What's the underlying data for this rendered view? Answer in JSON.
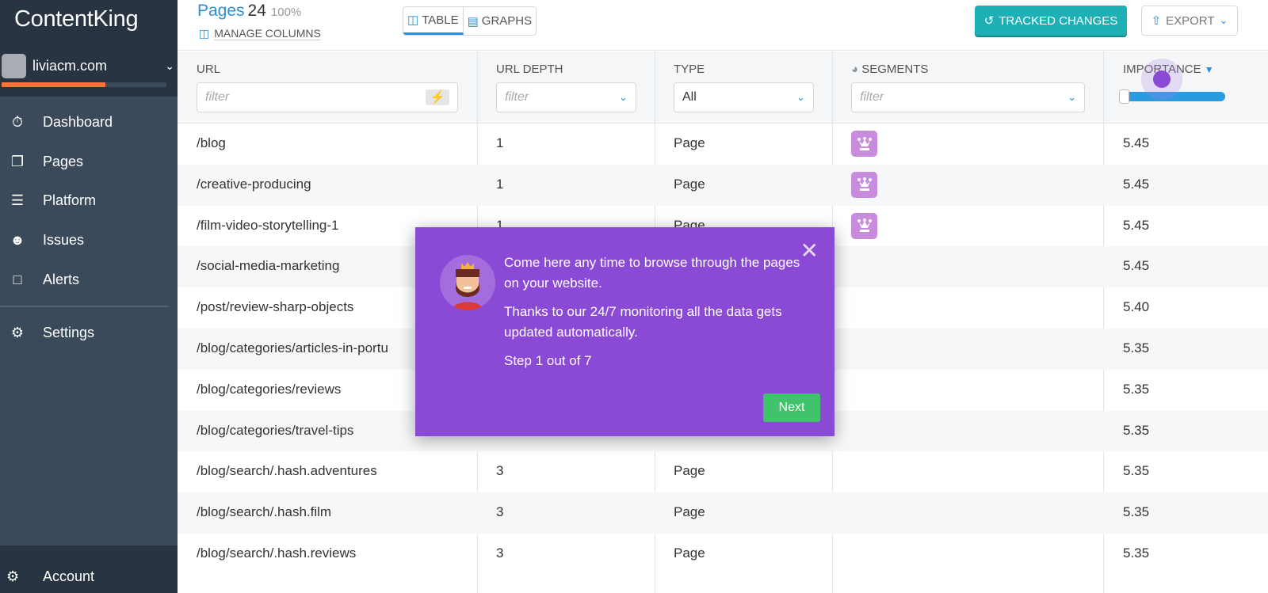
{
  "sidebar": {
    "logo": "ContentKing",
    "site": "liviacm.com",
    "site_progress": 0.63,
    "items": [
      {
        "label": "Dashboard",
        "icon": "gauge-icon"
      },
      {
        "label": "Pages",
        "icon": "pages-icon"
      },
      {
        "label": "Platform",
        "icon": "layers-icon"
      },
      {
        "label": "Issues",
        "icon": "bug-icon"
      },
      {
        "label": "Alerts",
        "icon": "pulse-icon"
      }
    ],
    "settings": "Settings",
    "account": "Account"
  },
  "header": {
    "title": "Pages",
    "count": "24",
    "percent": "100%",
    "manage_columns": "MANAGE COLUMNS",
    "table": "TABLE",
    "graphs": "GRAPHS",
    "tracked_changes": "TRACKED CHANGES",
    "export": "EXPORT"
  },
  "columns": {
    "url": "URL",
    "url_depth": "URL DEPTH",
    "type": "TYPE",
    "segments": "SEGMENTS",
    "importance": "IMPORTANCE",
    "filter_placeholder": "filter",
    "type_value": "All"
  },
  "rows": [
    {
      "url": "/blog",
      "depth": "1",
      "type": "Page",
      "segment": true,
      "importance": "5.45"
    },
    {
      "url": "/creative-producing",
      "depth": "1",
      "type": "Page",
      "segment": true,
      "importance": "5.45"
    },
    {
      "url": "/film-video-storytelling-1",
      "depth": "1",
      "type": "Page",
      "segment": true,
      "importance": "5.45"
    },
    {
      "url": "/social-media-marketing",
      "depth": "",
      "type": "",
      "segment": false,
      "importance": "5.45"
    },
    {
      "url": "/post/review-sharp-objects",
      "depth": "",
      "type": "",
      "segment": false,
      "importance": "5.40"
    },
    {
      "url": "/blog/categories/articles-in-portu",
      "depth": "",
      "type": "",
      "segment": false,
      "importance": "5.35"
    },
    {
      "url": "/blog/categories/reviews",
      "depth": "",
      "type": "",
      "segment": false,
      "importance": "5.35"
    },
    {
      "url": "/blog/categories/travel-tips",
      "depth": "",
      "type": "",
      "segment": false,
      "importance": "5.35"
    },
    {
      "url": "/blog/search/.hash.adventures",
      "depth": "3",
      "type": "Page",
      "segment": false,
      "importance": "5.35"
    },
    {
      "url": "/blog/search/.hash.film",
      "depth": "3",
      "type": "Page",
      "segment": false,
      "importance": "5.35"
    },
    {
      "url": "/blog/search/.hash.reviews",
      "depth": "3",
      "type": "Page",
      "segment": false,
      "importance": "5.35"
    }
  ],
  "popup": {
    "line1": "Come here any time to browse through the pages on your website.",
    "line2": "Thanks to our 24/7 monitoring all the data gets updated automatically.",
    "step": "Step 1 out of 7",
    "next": "Next"
  },
  "colors": {
    "accent": "#2a8fd6",
    "teal": "#1eb0b4",
    "popup": "#8a4ad5",
    "next": "#3fc46b",
    "progress": "#f5763a"
  }
}
